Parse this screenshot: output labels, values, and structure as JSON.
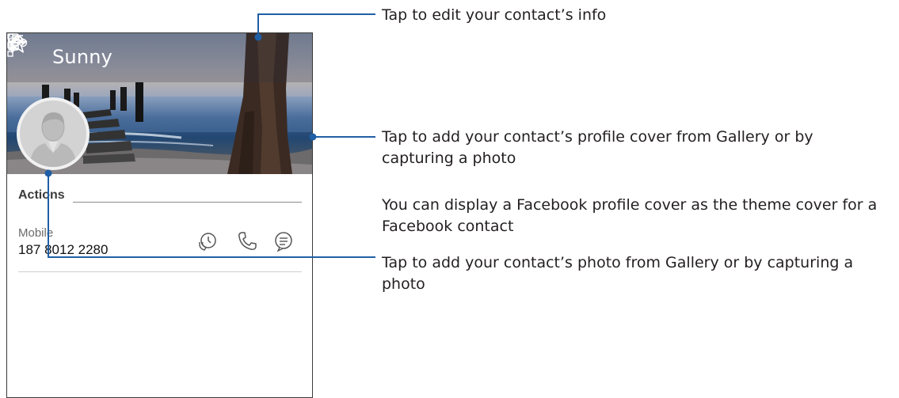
{
  "contact": {
    "name": "Sunny",
    "actions_heading": "Actions",
    "phone_type": "Mobile",
    "phone_number": "187 8012 2280"
  },
  "icons": {
    "back": "back-arrow-icon",
    "favorite": "star-icon",
    "edit": "pencil-icon",
    "more": "more-vertical-icon",
    "device": "phone-device-icon",
    "timeline": "timeline-icon",
    "history": "call-history-icon",
    "call": "phone-call-icon",
    "message": "message-icon",
    "avatar": "person-avatar-icon"
  },
  "callouts": {
    "edit_info": "Tap to edit your contact’s info",
    "profile_cover": "Tap to add your contact’s profile cover from Gallery or by capturing a photo",
    "facebook_cover": "You can display a Facebook profile cover as the theme cover for a Facebook contact",
    "contact_photo": "Tap to add your contact’s photo from Gallery or by capturing a photo"
  },
  "colors": {
    "callout_line": "#1f5fa5",
    "text": "#231f20"
  }
}
